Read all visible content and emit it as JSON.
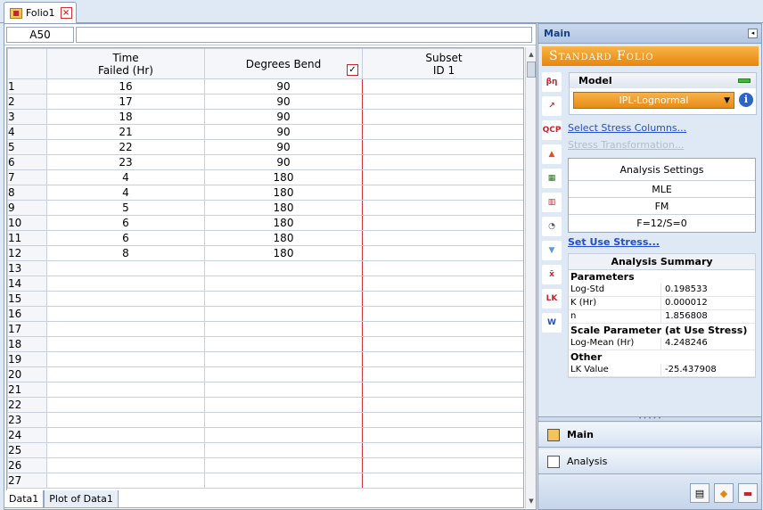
{
  "document_tab": {
    "title": "Folio1",
    "close_label": "×",
    "folder_icon": "folio-icon",
    "close_icon": "close-icon"
  },
  "formula_bar": {
    "cell_ref": "A50",
    "value": ""
  },
  "columns": [
    {
      "header_line1": "Time",
      "header_line2": "Failed (Hr)"
    },
    {
      "header_line1": "Degrees Bend",
      "header_line2": ""
    },
    {
      "header_line1": "Subset",
      "header_line2": "ID 1"
    }
  ],
  "column_check_mark": "✓",
  "rows": [
    {
      "num": "1",
      "time": "16",
      "deg": "90",
      "subset": ""
    },
    {
      "num": "2",
      "time": "17",
      "deg": "90",
      "subset": ""
    },
    {
      "num": "3",
      "time": "18",
      "deg": "90",
      "subset": ""
    },
    {
      "num": "4",
      "time": "21",
      "deg": "90",
      "subset": ""
    },
    {
      "num": "5",
      "time": "22",
      "deg": "90",
      "subset": ""
    },
    {
      "num": "6",
      "time": "23",
      "deg": "90",
      "subset": ""
    },
    {
      "num": "7",
      "time": "4",
      "deg": "180",
      "subset": ""
    },
    {
      "num": "8",
      "time": "4",
      "deg": "180",
      "subset": ""
    },
    {
      "num": "9",
      "time": "5",
      "deg": "180",
      "subset": ""
    },
    {
      "num": "10",
      "time": "6",
      "deg": "180",
      "subset": ""
    },
    {
      "num": "11",
      "time": "6",
      "deg": "180",
      "subset": ""
    },
    {
      "num": "12",
      "time": "8",
      "deg": "180",
      "subset": ""
    },
    {
      "num": "13",
      "time": "",
      "deg": "",
      "subset": ""
    },
    {
      "num": "14",
      "time": "",
      "deg": "",
      "subset": ""
    },
    {
      "num": "15",
      "time": "",
      "deg": "",
      "subset": ""
    },
    {
      "num": "16",
      "time": "",
      "deg": "",
      "subset": ""
    },
    {
      "num": "17",
      "time": "",
      "deg": "",
      "subset": ""
    },
    {
      "num": "18",
      "time": "",
      "deg": "",
      "subset": ""
    },
    {
      "num": "19",
      "time": "",
      "deg": "",
      "subset": ""
    },
    {
      "num": "20",
      "time": "",
      "deg": "",
      "subset": ""
    },
    {
      "num": "21",
      "time": "",
      "deg": "",
      "subset": ""
    },
    {
      "num": "22",
      "time": "",
      "deg": "",
      "subset": ""
    },
    {
      "num": "23",
      "time": "",
      "deg": "",
      "subset": ""
    },
    {
      "num": "24",
      "time": "",
      "deg": "",
      "subset": ""
    },
    {
      "num": "25",
      "time": "",
      "deg": "",
      "subset": ""
    },
    {
      "num": "26",
      "time": "",
      "deg": "",
      "subset": ""
    },
    {
      "num": "27",
      "time": "",
      "deg": "",
      "subset": ""
    }
  ],
  "sheet_tabs": [
    "Data1",
    "Plot of Data1"
  ],
  "scrollbar": {
    "up": "▲",
    "down": "▼"
  },
  "right_panel": {
    "header": "Main",
    "collapse_glyph": "◂",
    "banner": "Standard Folio",
    "model": {
      "title": "Model",
      "selected": "IPL-Lognormal",
      "dropdown_arrow": "▼",
      "info": "i"
    },
    "links": {
      "select_stress": "Select Stress Columns...",
      "stress_transform": "Stress Transformation...",
      "set_use_stress": "Set Use Stress..."
    },
    "settings": {
      "title": "Analysis Settings",
      "method": "MLE",
      "type": "FM",
      "counts": "F=12/S=0"
    },
    "summary": {
      "title": "Analysis Summary",
      "parameters_label": "Parameters",
      "parameters": [
        {
          "k": "Log-Std",
          "v": "0.198533"
        },
        {
          "k": "K (Hr)",
          "v": "0.000012"
        },
        {
          "k": "n",
          "v": "1.856808"
        }
      ],
      "scale_label": "Scale Parameter (at Use Stress)",
      "scale": [
        {
          "k": "Log-Mean (Hr)",
          "v": "4.248246"
        }
      ],
      "other_label": "Other",
      "other": [
        {
          "k": "LK Value",
          "v": "-25.437908"
        }
      ]
    },
    "tools": [
      {
        "name": "distribution-tool-icon",
        "glyph": "βη",
        "bg": "#ffffff",
        "color": "#c1272d"
      },
      {
        "name": "plot-tool-icon",
        "glyph": "↗",
        "bg": "#ffffff",
        "color": "#c1272d"
      },
      {
        "name": "qcp-tool-icon",
        "glyph": "QCP",
        "bg": "#ffffff",
        "color": "#c1272d"
      },
      {
        "name": "warning-tool-icon",
        "glyph": "▲",
        "bg": "#ffffff",
        "color": "#d9531e"
      },
      {
        "name": "grid-tool-icon",
        "glyph": "▦",
        "bg": "#ffffff",
        "color": "#2a6f1f"
      },
      {
        "name": "compare-tool-icon",
        "glyph": "▥",
        "bg": "#ffffff",
        "color": "#c1272d"
      },
      {
        "name": "gauge-tool-icon",
        "glyph": "◔",
        "bg": "#ffffff",
        "color": "#555555"
      },
      {
        "name": "filter-tool-icon",
        "glyph": "▼",
        "bg": "#ffffff",
        "color": "#5c9bd6"
      },
      {
        "name": "calc-tool-icon",
        "glyph": "x̄",
        "bg": "#ffffff",
        "color": "#c1272d"
      },
      {
        "name": "likelihood-tool-icon",
        "glyph": "LK",
        "bg": "#ffffff",
        "color": "#c1272d"
      },
      {
        "name": "word-export-icon",
        "glyph": "W",
        "bg": "#ffffff",
        "color": "#1f4fcc"
      }
    ],
    "nav": {
      "main": "Main",
      "analysis": "Analysis"
    },
    "splitter_dots": "• • • • •",
    "footer_buttons": [
      {
        "name": "sheet-view-icon",
        "glyph": "▤"
      },
      {
        "name": "diamond-calc-icon",
        "glyph": "◆"
      },
      {
        "name": "remove-icon",
        "glyph": "▬"
      }
    ]
  },
  "colors": {
    "accent_orange": "#e7860f",
    "grid_red": "#d0343a",
    "link_blue": "#1f4fcc"
  }
}
